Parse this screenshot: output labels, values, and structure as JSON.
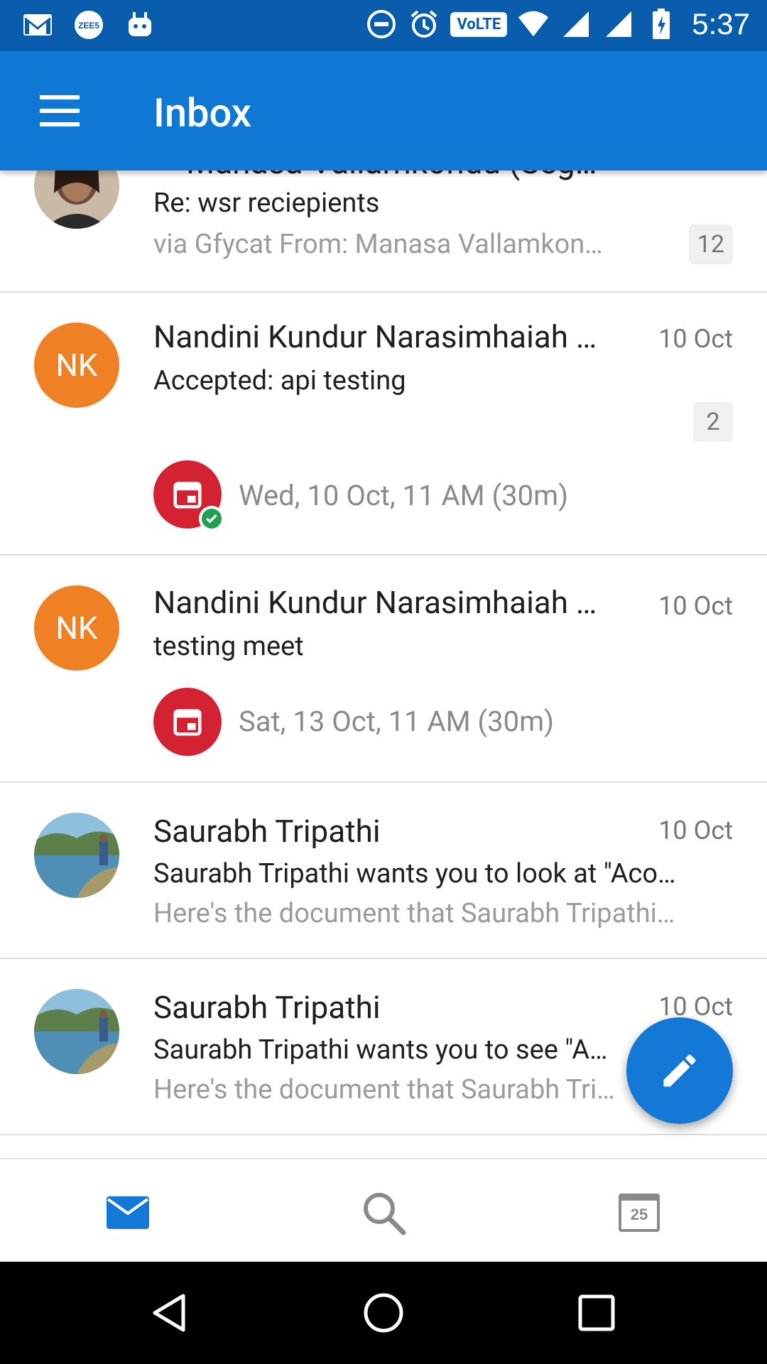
{
  "status_bar": {
    "time": "5:37",
    "volte": "VoLTE",
    "left_icons": [
      "gmail-icon",
      "zee5-icon",
      "android-bot-icon"
    ],
    "right_icons": [
      "do-not-disturb-icon",
      "alarm-icon",
      "volte-icon",
      "wifi-icon",
      "signal-icon",
      "signal-icon",
      "battery-icon"
    ]
  },
  "app_bar": {
    "title": "Inbox"
  },
  "messages": [
    {
      "sender": "Manasa Vallamkondu (Seg…",
      "subject": "Re: wsr reciepients",
      "preview": "via Gfycat From: Manasa Vallamkon…",
      "count": "12"
    },
    {
      "avatar": "NK",
      "sender": "Nandini Kundur Narasimhaiah …",
      "date": "10 Oct",
      "subject": "Accepted: api testing",
      "count": "2",
      "event": "Wed, 10 Oct, 11 AM (30m)"
    },
    {
      "avatar": "NK",
      "sender": "Nandini Kundur Narasimhaiah …",
      "date": "10 Oct",
      "subject": "testing meet",
      "event": "Sat, 13 Oct, 11 AM (30m)"
    },
    {
      "sender": "Saurabh Tripathi",
      "date": "10 Oct",
      "subject": "Saurabh Tripathi wants you to look at \"Aco…",
      "preview": "Here's the document that Saurabh Tripathi…"
    },
    {
      "sender": "Saurabh Tripathi",
      "date": "10 Oct",
      "subject": "Saurabh Tripathi wants you to see \"A…",
      "preview": "Here's the document that Saurabh Tri…"
    }
  ],
  "bottom_nav": {
    "calendar_day": "25",
    "items": [
      "mail-icon",
      "search-icon",
      "calendar-icon"
    ]
  },
  "colors": {
    "status_bar": "#0a5cad",
    "app_bar": "#0f78d4",
    "avatar_orange": "#f08024",
    "event_red": "#d32333",
    "fab": "#1478d6"
  }
}
